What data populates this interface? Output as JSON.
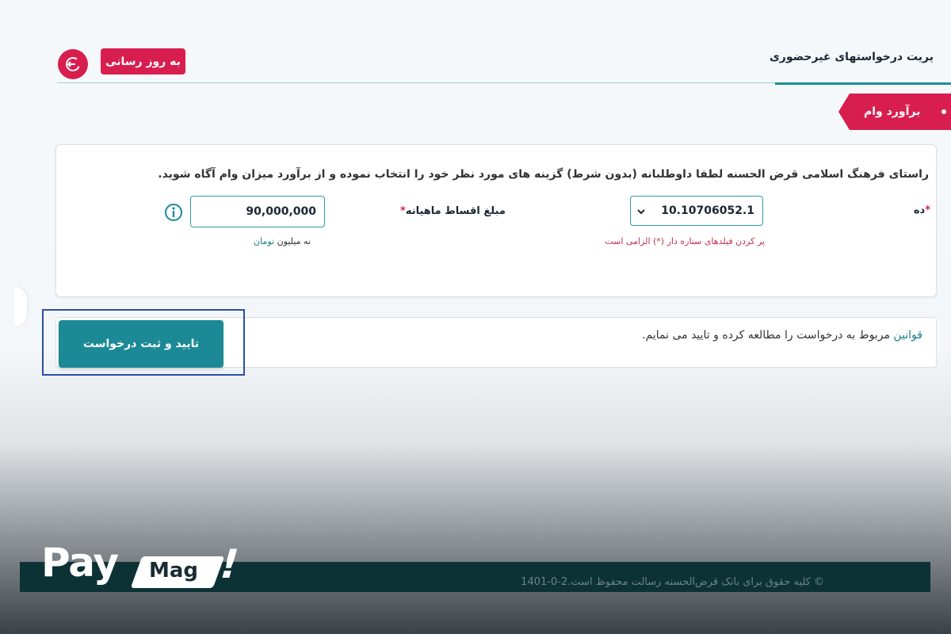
{
  "header": {
    "title": "یریت درخواستهای غیرحضوری",
    "update_button": "به روز رسانی"
  },
  "ribbon": {
    "label": "برآورد وام"
  },
  "form": {
    "instruction": "راستای فرهنگ اسلامی قرض الحسنه لطفا داوطلبانه (بدون شرط) گزینه های مورد نظر خود را انتخاب نموده و از برآورد میزان وام آگاه شوید.",
    "period_label": "ده",
    "period_value": "10.10706052.1",
    "period_error": "پر کردن فیلدهای ستاره دار (*) الزامی است",
    "monthly_label": "مبلغ اقساط ماهیانه",
    "monthly_value": "90,000,000",
    "monthly_hint_dark": "نه میلیون",
    "monthly_hint_unit": "تومان"
  },
  "terms": {
    "link": "قوانین",
    "text": "مربوط به درخواست را مطالعه کرده و تایید می نمایم."
  },
  "submit_button": "تایید و ثبت درخواست",
  "footer": {
    "text": "© کلیه حقوق برای بانک قرض‌الحسنه رسالت محفوظ است.2-0-1401"
  },
  "logo": {
    "pay": "Pay",
    "mag": "Mag",
    "bang": "!"
  },
  "colors": {
    "accent": "#d81e4f",
    "teal": "#1b8a96",
    "footer": "#0c3236",
    "highlight": "#2c4fa6"
  }
}
